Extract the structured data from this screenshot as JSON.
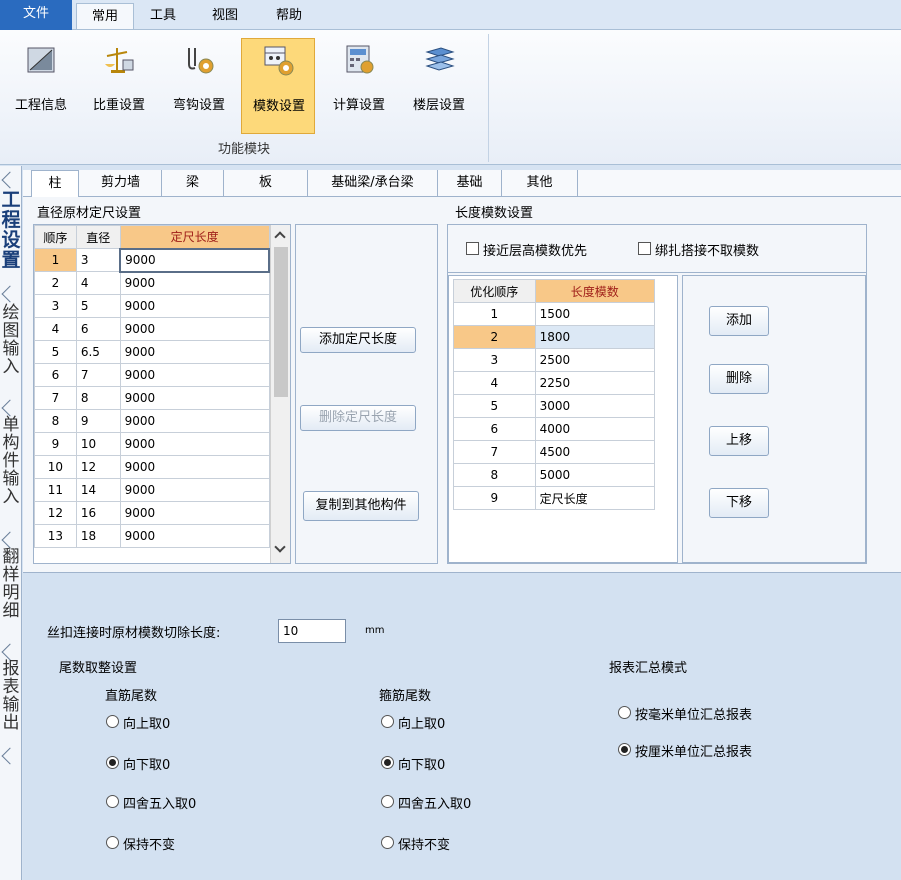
{
  "menubar": {
    "file": "文件",
    "common": "常用",
    "tools": "工具",
    "view": "视图",
    "help": "帮助"
  },
  "ribbon": {
    "buttons": [
      {
        "label": "工程信息",
        "icon": "project-info-icon"
      },
      {
        "label": "比重设置",
        "icon": "balance-icon"
      },
      {
        "label": "弯钩设置",
        "icon": "hook-settings-icon"
      },
      {
        "label": "模数设置",
        "icon": "modulus-settings-icon"
      },
      {
        "label": "计算设置",
        "icon": "calculator-icon"
      },
      {
        "label": "楼层设置",
        "icon": "floor-settings-icon"
      }
    ],
    "group_label": "功能模块"
  },
  "vtabs": [
    "工程设置",
    "绘图输入",
    "单构件输入",
    "翻样明细",
    "报表输出"
  ],
  "tabs": [
    "柱",
    "剪力墙",
    "梁",
    "板",
    "基础梁/承台梁",
    "基础",
    "其他"
  ],
  "diameter": {
    "title": "直径原材定尺设置",
    "headers": [
      "顺序",
      "直径",
      "定尺长度"
    ],
    "rows": [
      [
        "1",
        "3",
        "9000"
      ],
      [
        "2",
        "4",
        "9000"
      ],
      [
        "3",
        "5",
        "9000"
      ],
      [
        "4",
        "6",
        "9000"
      ],
      [
        "5",
        "6.5",
        "9000"
      ],
      [
        "6",
        "7",
        "9000"
      ],
      [
        "7",
        "8",
        "9000"
      ],
      [
        "8",
        "9",
        "9000"
      ],
      [
        "9",
        "10",
        "9000"
      ],
      [
        "10",
        "12",
        "9000"
      ],
      [
        "11",
        "14",
        "9000"
      ],
      [
        "12",
        "16",
        "9000"
      ],
      [
        "13",
        "18",
        "9000"
      ]
    ],
    "btn_add": "添加定尺长度",
    "btn_delete": "删除定尺长度",
    "btn_copy": "复制到其他构件"
  },
  "length": {
    "title": "长度模数设置",
    "chk_near": "接近层高模数优先",
    "chk_lap": "绑扎搭接不取模数",
    "headers": [
      "优化顺序",
      "长度模数"
    ],
    "rows": [
      [
        "1",
        "1500"
      ],
      [
        "2",
        "1800"
      ],
      [
        "3",
        "2500"
      ],
      [
        "4",
        "2250"
      ],
      [
        "5",
        "3000"
      ],
      [
        "6",
        "4000"
      ],
      [
        "7",
        "4500"
      ],
      [
        "8",
        "5000"
      ],
      [
        "9",
        "定尺长度"
      ]
    ],
    "btn_add": "添加",
    "btn_delete": "删除",
    "btn_up": "上移",
    "btn_down": "下移"
  },
  "bottom": {
    "cut_label": "丝扣连接时原材模数切除长度:",
    "cut_value": "10",
    "cut_unit": "mm",
    "round_title": "尾数取整设置",
    "straight_title": "直筋尾数",
    "stirrup_title": "箍筋尾数",
    "options": [
      "向上取0",
      "向下取0",
      "四舍五入取0",
      "保持不变"
    ],
    "straight_selected": 1,
    "stirrup_selected": 1,
    "report_title": "报表汇总模式",
    "report_options": [
      "按毫米单位汇总报表",
      "按厘米单位汇总报表"
    ],
    "report_selected": 1
  }
}
